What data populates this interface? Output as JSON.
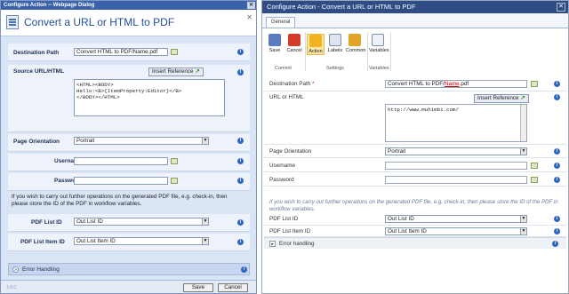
{
  "left": {
    "window_title": "Configure Action -- Webpage Dialog",
    "header_title": "Convert a URL or HTML to PDF",
    "fields": {
      "destination_label": "Destination Path",
      "destination_value": "Convert HTML to PDF/Name.pdf",
      "source_label": "Source URL/HTML",
      "insert_reference": "Insert Reference",
      "source_value": "<HTML><BODY>\nHello:<B>{ItemProperty:Editor}</B>\n</BODY></HTML>",
      "orientation_label": "Page Orientation",
      "orientation_value": "Portrait",
      "username_label": "Username",
      "username_value": "",
      "password_label": "Password",
      "password_value": "",
      "note": "If you wish to carry out further operations on the generated PDF file, e.g. check-in, then please store the ID of the PDF in workflow variables.",
      "pdf_list_id_label": "PDF List ID",
      "pdf_list_id_value": "Out List ID",
      "pdf_list_item_id_label": "PDF List Item ID",
      "pdf_list_item_id_value": "Out List Item ID"
    },
    "error_handling": "Error Handling",
    "save": "Save",
    "cancel": "Cancel",
    "version": "1.0.0"
  },
  "right": {
    "window_title": "Configure Action - Convert a URL or HTML to PDF",
    "tab_general": "General",
    "ribbon": {
      "save": "Save",
      "cancel": "Cancel",
      "action": "Action",
      "labels": "Labels",
      "common": "Common",
      "variables": "Variables",
      "group_commit": "Commit",
      "group_settings": "Settings",
      "group_variables": "Variables"
    },
    "fields": {
      "destination_label": "Destination Path",
      "destination_required": "*",
      "destination_prefix": "Convert HTML to PDF/",
      "destination_name": "Name",
      "destination_suffix": ".pdf",
      "source_label": "URL or HTML",
      "insert_reference": "Insert Reference",
      "source_value": "http://www.muhimbi.com/",
      "orientation_label": "Page Orientation",
      "orientation_value": "Portrait",
      "username_label": "Username",
      "username_value": "",
      "password_label": "Password",
      "password_value": "",
      "note": "If you wish to carry out further operations on the generated PDF file, e.g. check-in, then please store the ID of the PDF in workflow variables.",
      "pdf_list_id_label": "PDF List ID",
      "pdf_list_id_value": "Out List ID",
      "pdf_list_item_id_label": "PDF List Item ID",
      "pdf_list_item_id_value": "Out List Item ID"
    },
    "error_handling": "Error handling"
  },
  "colors": {
    "dialog_blue": "#3b62a8",
    "title_blue": "#1f4e9b",
    "info_blue": "#2e66c4",
    "name_red": "#cc0000"
  }
}
